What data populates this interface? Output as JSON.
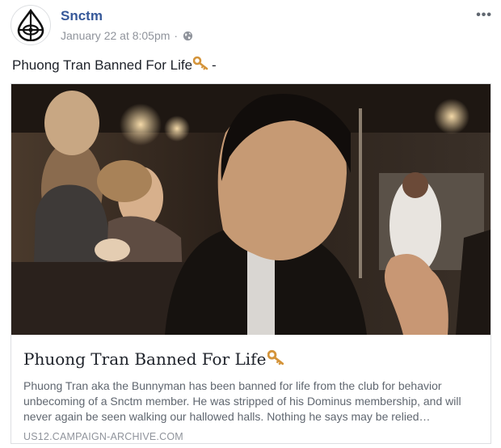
{
  "post": {
    "page_name": "Snctm",
    "timestamp": "January 22 at 8:05pm",
    "separator": "·",
    "audience_icon": "globe-icon",
    "more_label": "•••",
    "text_before": "Phuong Tran Banned For Life",
    "text_after": "-",
    "emoji_icon": "key-icon"
  },
  "link": {
    "title": "Phuong Tran Banned For Life",
    "description": "Phuong Tran aka the Bunnyman has been banned for life from the club for behavior unbecoming of a Snctm member. He was stripped of his Dominus membership, and will never again be seen walking our hallowed halls. Nothing he says may be relied…",
    "domain": "US12.CAMPAIGN-ARCHIVE.COM"
  },
  "colors": {
    "page_name": "#365899",
    "meta": "#90949c",
    "text": "#1d2129",
    "border": "#dddfe2",
    "key_gold": "#d4943a"
  }
}
